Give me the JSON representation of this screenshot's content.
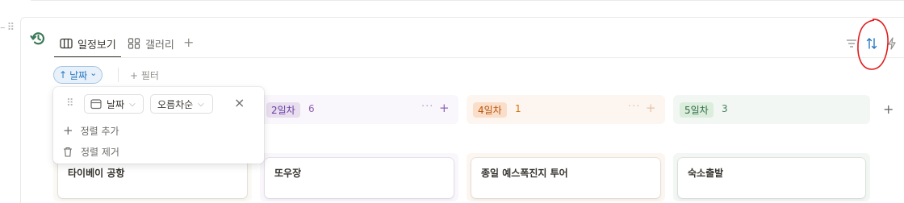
{
  "tabs": [
    {
      "label": "일정보기",
      "icon": "board-icon",
      "active": true
    },
    {
      "label": "갤러리",
      "icon": "gallery-icon",
      "active": false
    }
  ],
  "add_view_label": "+",
  "sort_chip": {
    "arrow": "↑",
    "label": "날짜",
    "chevron": "⌄"
  },
  "filter_label": "+ 필터",
  "groups": [
    {
      "label": "2일차",
      "count": "6",
      "bg": "#f9f6fc",
      "tag_bg": "#e8deee",
      "text": "#9065b0"
    },
    {
      "label": "4일차",
      "count": "1",
      "bg": "#fdf6f0",
      "tag_bg": "#fadec9",
      "text": "#d9730d"
    },
    {
      "label": "5일차",
      "count": "3",
      "bg": "#f3f7f4",
      "tag_bg": "#dbeddb",
      "text": "#448361"
    }
  ],
  "group_dots": "···",
  "group_plus": "+",
  "add_group": "+",
  "cards": [
    {
      "title": "타이베이 공항"
    },
    {
      "title": "또우장"
    },
    {
      "title": "종일 예스폭진지 투어"
    },
    {
      "title": "숙소출발"
    }
  ],
  "sort_popup": {
    "property": "날짜",
    "direction": "오름차순",
    "close": "×",
    "add_sort": "정렬 추가",
    "remove_sort": "정렬 제거"
  },
  "colors": {
    "accent": "#2b79c2",
    "annotation": "#e01b1b"
  }
}
